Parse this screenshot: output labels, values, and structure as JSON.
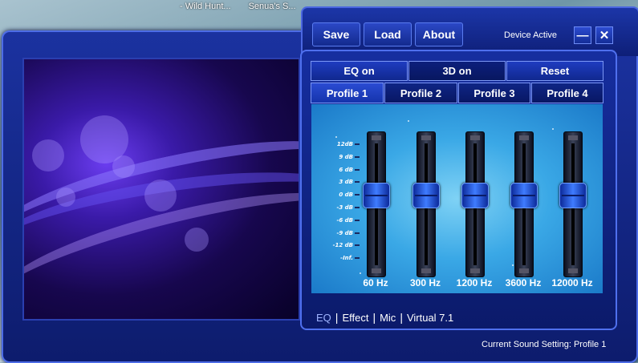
{
  "desktop": {
    "window_titles": [
      "- Wild Hunt...",
      "Senua's S..."
    ]
  },
  "toolbar": {
    "save": "Save",
    "load": "Load",
    "about": "About"
  },
  "device_status": "Device Active",
  "window_controls": {
    "minimize": "—",
    "close": "✕"
  },
  "modes": [
    {
      "label": "EQ on",
      "active": false
    },
    {
      "label": "3D on",
      "active": true
    },
    {
      "label": "Reset",
      "active": false
    }
  ],
  "profiles": [
    {
      "label": "Profile 1",
      "active": true
    },
    {
      "label": "Profile 2",
      "active": false
    },
    {
      "label": "Profile 3",
      "active": false
    },
    {
      "label": "Profile 4",
      "active": false
    }
  ],
  "eq": {
    "scale": [
      "12dB",
      "9 dB",
      "6 dB",
      "3 dB",
      "0 dB",
      "-3 dB",
      "-6 dB",
      "-9 dB",
      "-12 dB",
      "-Inf."
    ],
    "bands": [
      {
        "freq": "60 Hz",
        "gain_db": 0
      },
      {
        "freq": "300 Hz",
        "gain_db": 0
      },
      {
        "freq": "1200 Hz",
        "gain_db": 0
      },
      {
        "freq": "3600 Hz",
        "gain_db": 0
      },
      {
        "freq": "12000 Hz",
        "gain_db": 0
      }
    ]
  },
  "sub_tabs": {
    "items": [
      "EQ",
      "Effect",
      "Mic",
      "Virtual 7.1"
    ],
    "separator": "|",
    "active": "EQ"
  },
  "footer": "Current Sound Setting: Profile 1"
}
